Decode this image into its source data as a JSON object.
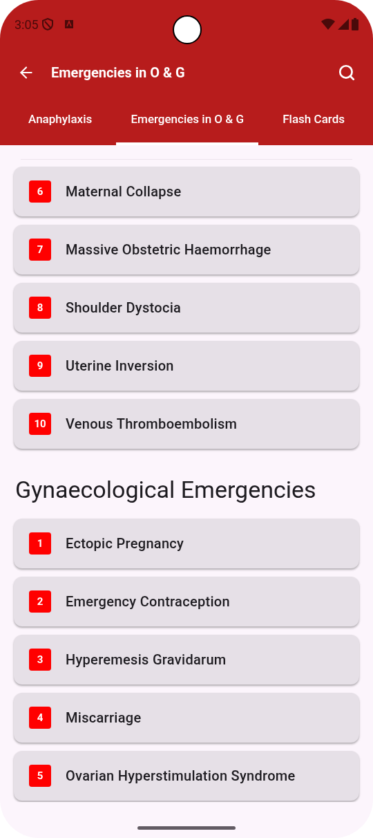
{
  "status_bar": {
    "time": "3:05"
  },
  "app_bar": {
    "title": "Emergencies in O & G"
  },
  "tabs": [
    {
      "label": "Anaphylaxis",
      "selected": false
    },
    {
      "label": "Emergencies in O & G",
      "selected": true
    },
    {
      "label": "Flash Cards",
      "selected": false
    }
  ],
  "groups": [
    {
      "items": [
        {
          "number": "6",
          "title": "Maternal Collapse"
        },
        {
          "number": "7",
          "title": "Massive Obstetric Haemorrhage"
        },
        {
          "number": "8",
          "title": "Shoulder Dystocia"
        },
        {
          "number": "9",
          "title": "Uterine Inversion"
        },
        {
          "number": "10",
          "title": "Venous Thromboembolism"
        }
      ]
    },
    {
      "heading": "Gynaecological Emergencies",
      "items": [
        {
          "number": "1",
          "title": "Ectopic Pregnancy"
        },
        {
          "number": "2",
          "title": "Emergency Contraception"
        },
        {
          "number": "3",
          "title": "Hyperemesis Gravidarum"
        },
        {
          "number": "4",
          "title": "Miscarriage"
        },
        {
          "number": "5",
          "title": "Ovarian Hyperstimulation Syndrome"
        }
      ]
    }
  ]
}
